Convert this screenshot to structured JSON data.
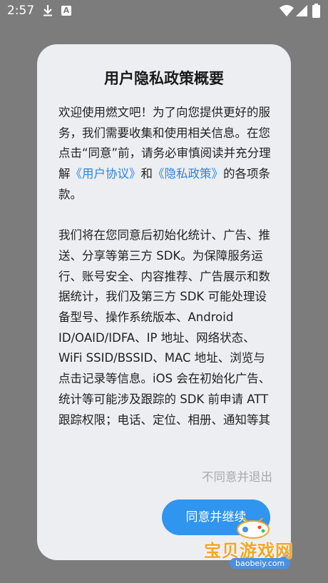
{
  "status_bar": {
    "time": "2:57",
    "a_badge": "A",
    "icons": [
      "download-icon",
      "a-badge-icon",
      "wifi-icon",
      "signal-icon",
      "battery-icon"
    ]
  },
  "dialog": {
    "title": "用户隐私政策概要",
    "para1": {
      "text1": "欢迎使用燃文吧！为了向您提供更好的服务，我们需要收集和使用相关信息。在您点击“同意”前，请务必审慎阅读并充分理解",
      "link_user_agreement": "《用户协议》",
      "text2": "和",
      "link_privacy_policy": "《隐私政策》",
      "text3": "的各项条款。"
    },
    "para2": "我们将在您同意后初始化统计、广告、推送、分享等第三方 SDK。为保障服务运行、账号安全、内容推荐、广告展示和数据统计，我们及第三方 SDK 可能处理设备型号、操作系统版本、Android ID/OAID/IDFA、IP 地址、网络状态、WiFi SSID/BSSID、MAC 地址、浏览与点击记录等信息。iOS 会在初始化广告、统计等可能涉及跟踪的 SDK 前申请 ATT 跟踪权限；电话、定位、相册、通知等其他",
    "decline_label": "不同意并退出",
    "agree_label": "同意并继续"
  },
  "watermark": {
    "text": "宝贝游戏网",
    "url": "baobeiy.com"
  },
  "colors": {
    "overlay": "#7c7c7c",
    "dialog_bg": "#eceef2",
    "link": "#2a86e2",
    "primary_button": "#2f95ef",
    "secondary_text": "#a7a9ad"
  }
}
